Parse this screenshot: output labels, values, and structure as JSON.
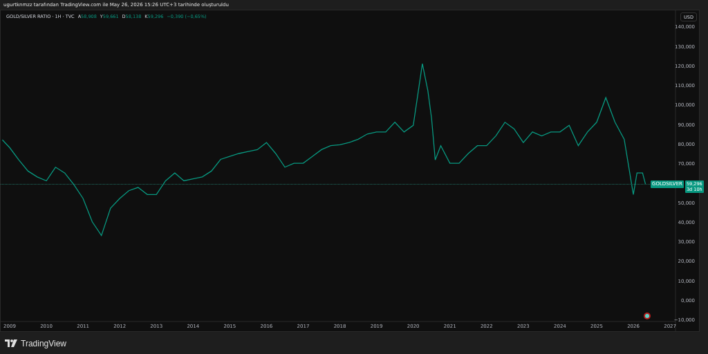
{
  "top_bar": {
    "caption": "ugurtknmzz tarafından TradingView.com ile May 26, 2026 15:26 UTC+3 tarihinde oluşturuldu"
  },
  "legend": {
    "symbol": "GOLD/SILVER RATIO · 1H · TVC",
    "ohlc": [
      {
        "label": "A",
        "value": "58,908"
      },
      {
        "label": "Y",
        "value": "59,661"
      },
      {
        "label": "D",
        "value": "58,138"
      },
      {
        "label": "K",
        "value": "59,296"
      }
    ],
    "change": "−0,390 (−0,65%)"
  },
  "currency_button": "USD",
  "price_tag": {
    "name": "GOLDSILVER",
    "value": "59,296",
    "countdown": "3d 10h"
  },
  "chart_data": {
    "type": "line",
    "x": [
      2008.8,
      2009.0,
      2009.25,
      2009.5,
      2009.75,
      2010.0,
      2010.25,
      2010.5,
      2010.75,
      2011.0,
      2011.25,
      2011.5,
      2011.75,
      2012.0,
      2012.25,
      2012.5,
      2012.75,
      2013.0,
      2013.25,
      2013.5,
      2013.75,
      2014.0,
      2014.25,
      2014.5,
      2014.75,
      2015.0,
      2015.25,
      2015.5,
      2015.75,
      2016.0,
      2016.25,
      2016.5,
      2016.75,
      2017.0,
      2017.25,
      2017.5,
      2017.75,
      2018.0,
      2018.25,
      2018.5,
      2018.75,
      2019.0,
      2019.25,
      2019.5,
      2019.75,
      2020.0,
      2020.25,
      2020.4,
      2020.5,
      2020.6,
      2020.75,
      2021.0,
      2021.25,
      2021.5,
      2021.75,
      2022.0,
      2022.25,
      2022.5,
      2022.75,
      2023.0,
      2023.25,
      2023.5,
      2023.75,
      2024.0,
      2024.25,
      2024.5,
      2024.75,
      2025.0,
      2025.25,
      2025.5,
      2025.75,
      2026.0,
      2026.1,
      2026.25,
      2026.33
    ],
    "series": [
      {
        "color": "#089981",
        "values": [
          82,
          78,
          71.7,
          66,
          63,
          61,
          68,
          65,
          59,
          52,
          40,
          33,
          47,
          52,
          56,
          57.6,
          54,
          54,
          61,
          65,
          61,
          62,
          63,
          66,
          72,
          73.5,
          75,
          76,
          77,
          80.6,
          75,
          68,
          70,
          70,
          73.5,
          77,
          79,
          79.5,
          80.6,
          82.3,
          85,
          86,
          86,
          91,
          86,
          89.4,
          121,
          107,
          93,
          71.7,
          79,
          70,
          70,
          75,
          79,
          79,
          84,
          91,
          87.6,
          80.6,
          86,
          84,
          86,
          86,
          89.4,
          79,
          86,
          91,
          103.6,
          91,
          82.3,
          54,
          65,
          65,
          59.3
        ]
      }
    ],
    "xlim": [
      2008.755,
      2027.13
    ],
    "ylim": [
      -10.69,
      148.3
    ],
    "xticks": [
      {
        "value": 2009,
        "label": "2009"
      },
      {
        "value": 2010,
        "label": "2010"
      },
      {
        "value": 2011,
        "label": "2011"
      },
      {
        "value": 2012,
        "label": "2012"
      },
      {
        "value": 2013,
        "label": "2013"
      },
      {
        "value": 2014,
        "label": "2014"
      },
      {
        "value": 2015,
        "label": "2015"
      },
      {
        "value": 2016,
        "label": "2016"
      },
      {
        "value": 2017,
        "label": "2017"
      },
      {
        "value": 2018,
        "label": "2018"
      },
      {
        "value": 2019,
        "label": "2019"
      },
      {
        "value": 2020,
        "label": "2020"
      },
      {
        "value": 2021,
        "label": "2021"
      },
      {
        "value": 2022,
        "label": "2022"
      },
      {
        "value": 2023,
        "label": "2023"
      },
      {
        "value": 2024,
        "label": "2024"
      },
      {
        "value": 2025,
        "label": "2025"
      },
      {
        "value": 2026,
        "label": "2026"
      },
      {
        "value": 2027,
        "label": "2027"
      }
    ],
    "yticks": [
      {
        "value": 140,
        "label": "140,000"
      },
      {
        "value": 130,
        "label": "130,000"
      },
      {
        "value": 120,
        "label": "120,000"
      },
      {
        "value": 110,
        "label": "110,000"
      },
      {
        "value": 100,
        "label": "100,000"
      },
      {
        "value": 90,
        "label": "90,000"
      },
      {
        "value": 80,
        "label": "80,000"
      },
      {
        "value": 70,
        "label": "70,000"
      },
      {
        "value": 50,
        "label": "50,000"
      },
      {
        "value": 40,
        "label": "40,000"
      },
      {
        "value": 30,
        "label": "30,000"
      },
      {
        "value": 20,
        "label": "20,000"
      },
      {
        "value": 10,
        "label": "10,000"
      },
      {
        "value": 0,
        "label": "0,000"
      },
      {
        "value": -10,
        "label": "−10,000"
      }
    ]
  },
  "footer": {
    "brand": "TradingView"
  }
}
